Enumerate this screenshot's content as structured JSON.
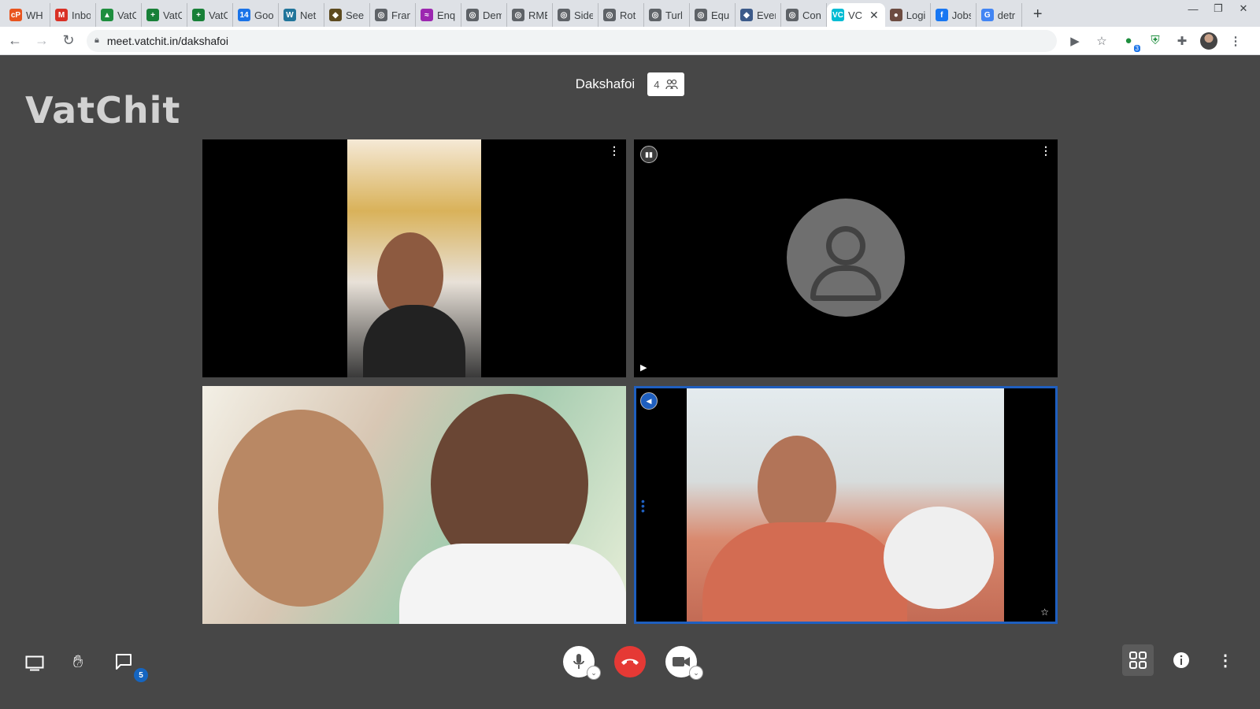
{
  "browser": {
    "tabs": [
      {
        "title": "WH",
        "icon": "contact-logo",
        "color": "#e8541e",
        "glyph": "cP"
      },
      {
        "title": "Inbo",
        "icon": "gmail-logo",
        "color": "#d93025",
        "glyph": "M"
      },
      {
        "title": "VatC",
        "icon": "google-drive-logo",
        "color": "#1e8e3e",
        "glyph": "▲"
      },
      {
        "title": "VatC",
        "icon": "google-sheets-logo",
        "color": "#188038",
        "glyph": "+"
      },
      {
        "title": "VatC",
        "icon": "google-sheets-logo",
        "color": "#188038",
        "glyph": "+"
      },
      {
        "title": "Goo",
        "icon": "google-calendar-logo",
        "color": "#1a73e8",
        "glyph": "14"
      },
      {
        "title": "Net",
        "icon": "wordpress-logo",
        "color": "#21759b",
        "glyph": "W"
      },
      {
        "title": "Seel",
        "icon": "shield-logo",
        "color": "#5d4a1f",
        "glyph": "◆"
      },
      {
        "title": "Fran",
        "icon": "globe-icon",
        "color": "#5f6368",
        "glyph": "◎"
      },
      {
        "title": "Enq",
        "icon": "wave-logo",
        "color": "#9c27b0",
        "glyph": "≈"
      },
      {
        "title": "Dem",
        "icon": "globe-icon",
        "color": "#5f6368",
        "glyph": "◎"
      },
      {
        "title": "RMB",
        "icon": "globe-icon",
        "color": "#5f6368",
        "glyph": "◎"
      },
      {
        "title": "Side",
        "icon": "globe-icon",
        "color": "#5f6368",
        "glyph": "◎"
      },
      {
        "title": "Rot",
        "icon": "globe-icon",
        "color": "#5f6368",
        "glyph": "◎"
      },
      {
        "title": "Turl",
        "icon": "globe-icon",
        "color": "#5f6368",
        "glyph": "◎"
      },
      {
        "title": "Equ",
        "icon": "globe-icon",
        "color": "#5f6368",
        "glyph": "◎"
      },
      {
        "title": "Ever",
        "icon": "crest-logo",
        "color": "#3c5a8a",
        "glyph": "◆"
      },
      {
        "title": "Con",
        "icon": "globe-icon",
        "color": "#5f6368",
        "glyph": "◎"
      },
      {
        "title": "VC",
        "icon": "vatchit-logo",
        "color": "#00bcd4",
        "glyph": "VC",
        "active": true
      },
      {
        "title": "Logi",
        "icon": "owl-logo",
        "color": "#6d4c41",
        "glyph": "●"
      },
      {
        "title": "Jobs",
        "icon": "facebook-logo",
        "color": "#1877f2",
        "glyph": "f"
      },
      {
        "title": "detr",
        "icon": "google-logo",
        "color": "#4285f4",
        "glyph": "G"
      }
    ],
    "url": "meet.vatchit.in/dakshafoi",
    "extension_badge": "3"
  },
  "app": {
    "logo_text": "VatChit",
    "meeting_title": "Dakshafoi",
    "participant_count": "4",
    "chat_unread": "5",
    "accent_color": "#1f5fbf",
    "hangup_color": "#e53935"
  },
  "tiles": [
    {
      "name": "tile-participant-1",
      "camera": "on"
    },
    {
      "name": "tile-participant-2",
      "camera": "off"
    },
    {
      "name": "tile-participant-3",
      "camera": "on"
    },
    {
      "name": "tile-participant-4",
      "camera": "on",
      "active_speaker": true
    }
  ]
}
